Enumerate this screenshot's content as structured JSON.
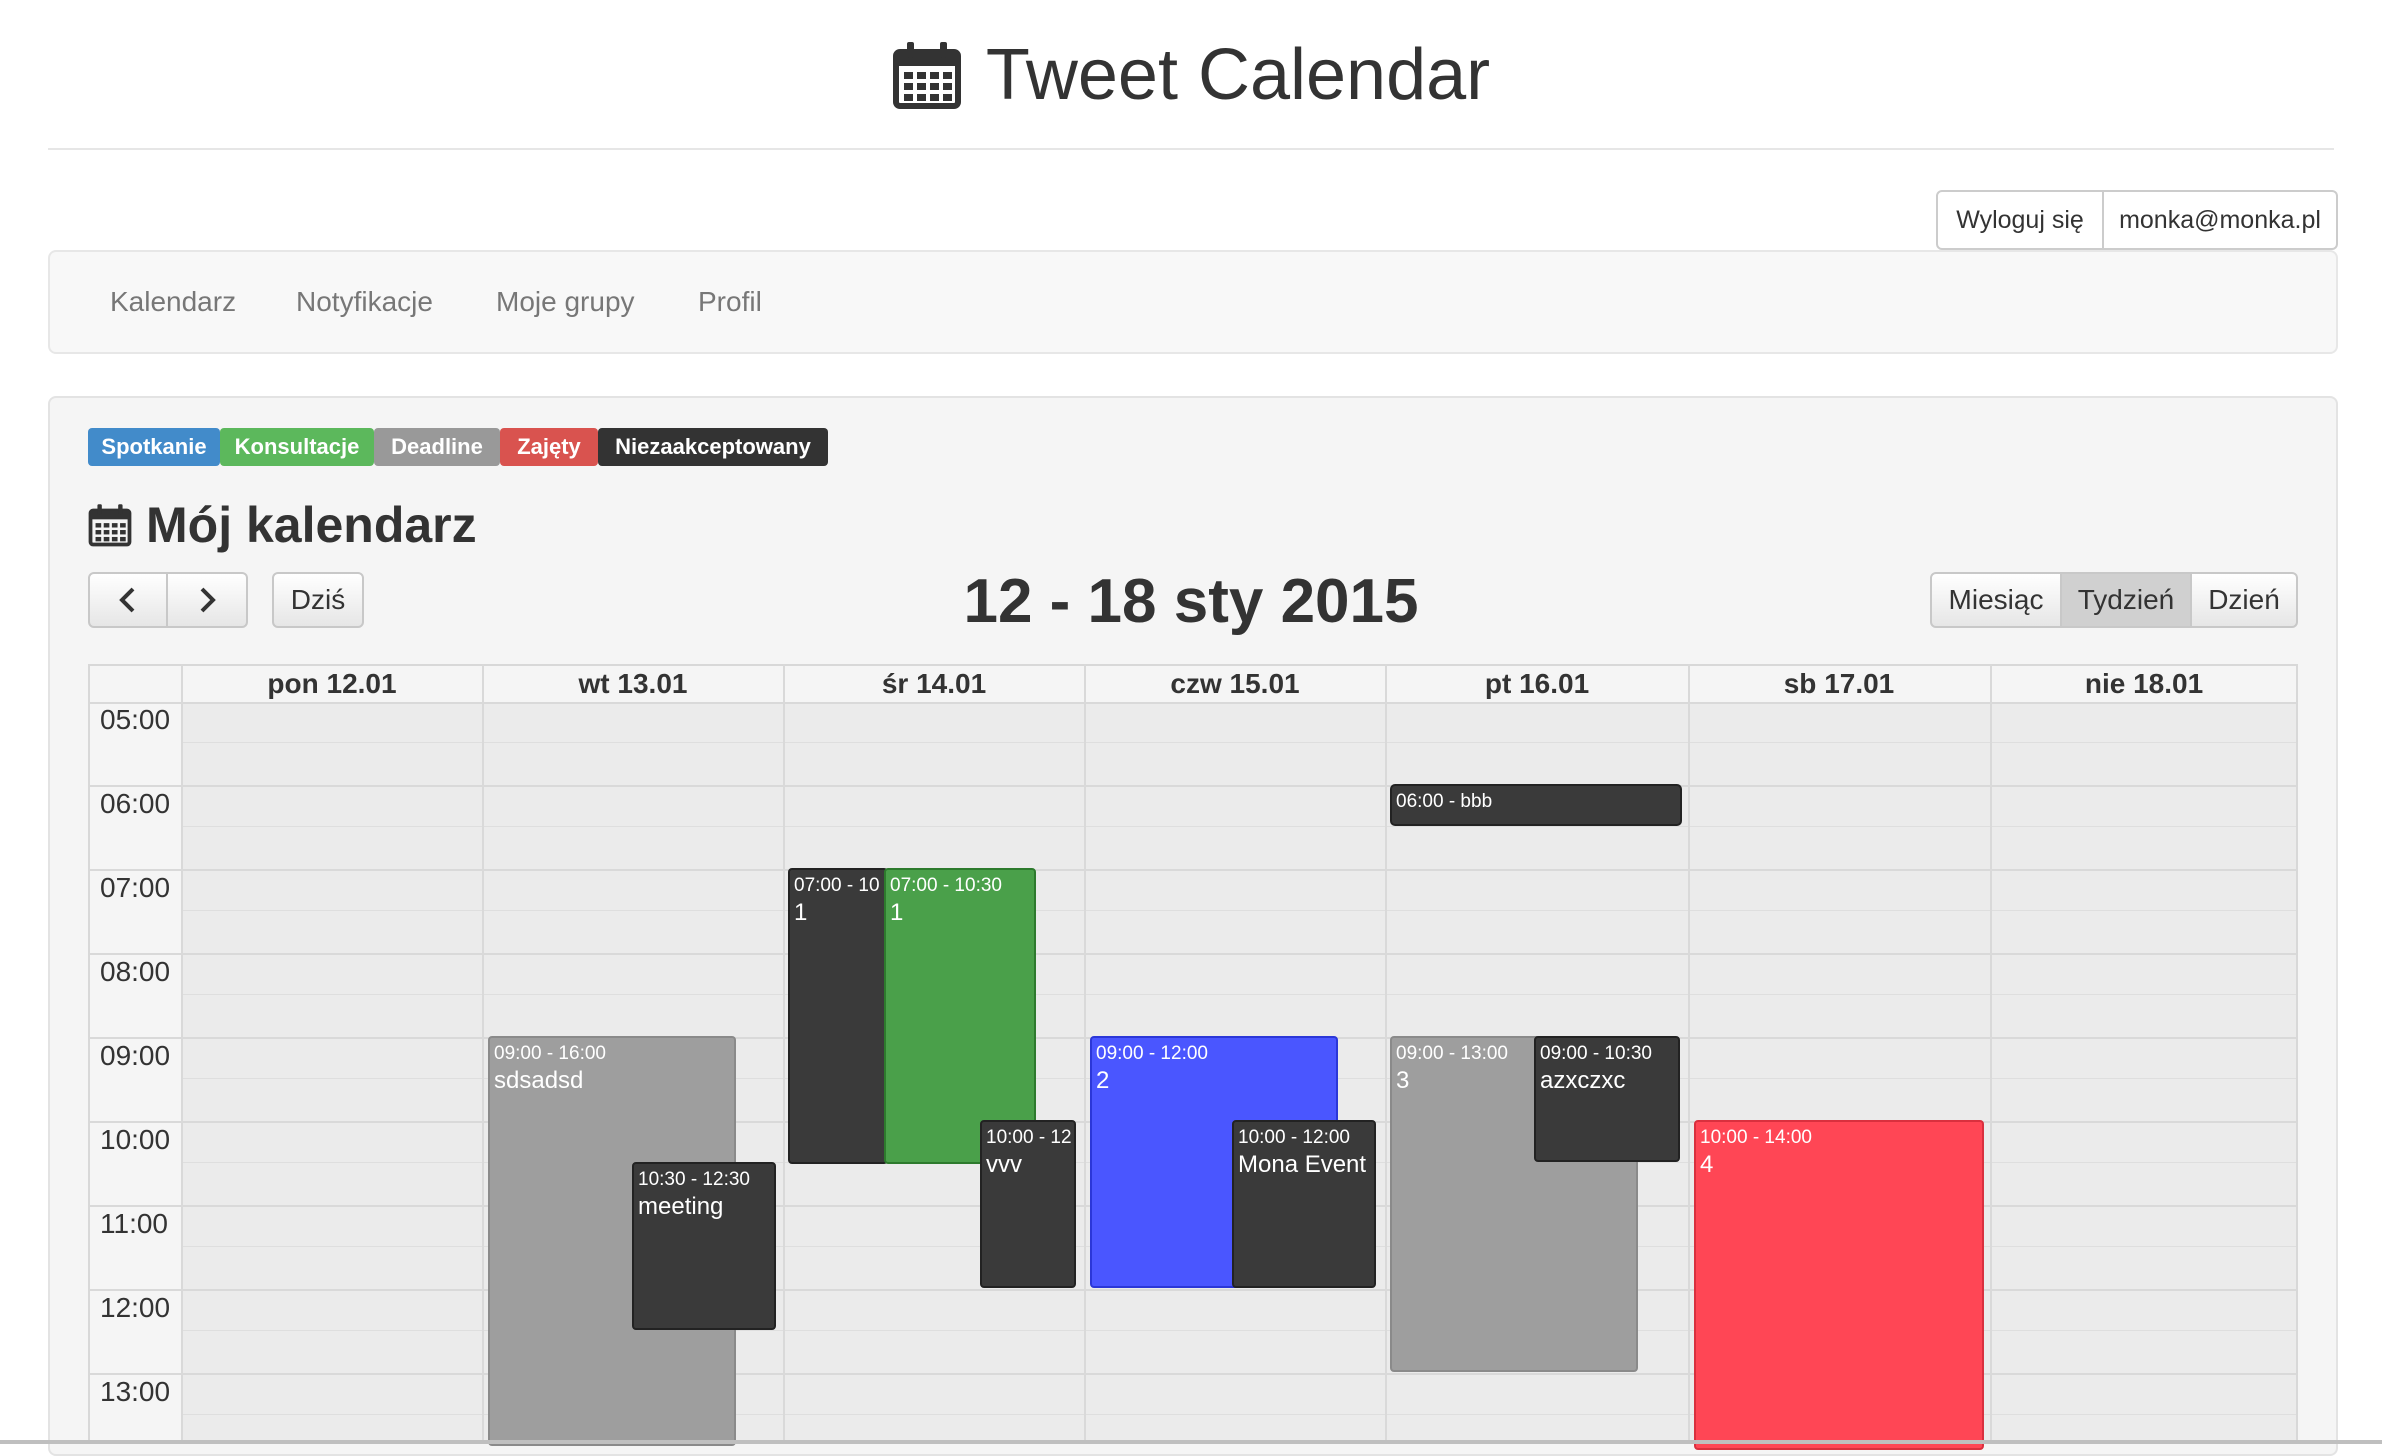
{
  "header": {
    "title": "Tweet Calendar",
    "icon": "calendar-icon"
  },
  "user": {
    "logout_label": "Wyloguj się",
    "email": "monka@monka.pl"
  },
  "nav": {
    "items": [
      "Kalendarz",
      "Notyfikacje",
      "Moje grupy",
      "Profil"
    ]
  },
  "legend": [
    {
      "label": "Spotkanie",
      "color": "#428bca"
    },
    {
      "label": "Konsultacje",
      "color": "#5cb85c"
    },
    {
      "label": "Deadline",
      "color": "#999999"
    },
    {
      "label": "Zajęty",
      "color": "#d9534f"
    },
    {
      "label": "Niezaakceptowany",
      "color": "#333333"
    }
  ],
  "calendar": {
    "section_title": "Mój kalendarz",
    "range": "12 - 18 sty 2015",
    "today_label": "Dziś",
    "views": [
      "Miesiąc",
      "Tydzień",
      "Dzień"
    ],
    "active_view": "Tydzień",
    "days": [
      "pon 12.01",
      "wt 13.01",
      "śr 14.01",
      "czw 15.01",
      "pt 16.01",
      "sb 17.01",
      "nie 18.01"
    ],
    "times": [
      "05:00",
      "06:00",
      "07:00",
      "08:00",
      "09:00",
      "10:00",
      "11:00",
      "12:00",
      "13:00"
    ],
    "events": [
      {
        "time": "06:00 - bbb",
        "title": "",
        "color": "#3a3a3a"
      },
      {
        "time": "07:00 - 10",
        "title": "1",
        "color": "#3a3a3a"
      },
      {
        "time": "07:00 - 10:30",
        "title": "1",
        "color": "#4aa04a"
      },
      {
        "time": "10:00 - 12",
        "title": "vvv",
        "color": "#3a3a3a"
      },
      {
        "time": "09:00 - 16:00",
        "title": "sdsadsd",
        "color": "#9e9e9e"
      },
      {
        "time": "10:30 - 12:30",
        "title": "meeting",
        "color": "#3a3a3a"
      },
      {
        "time": "09:00 - 12:00",
        "title": "2",
        "color": "#4a56ff"
      },
      {
        "time": "10:00 - 12:00",
        "title": "Mona Event",
        "color": "#3a3a3a"
      },
      {
        "time": "09:00 - 13:00",
        "title": "3",
        "color": "#9e9e9e"
      },
      {
        "time": "09:00 - 10:30",
        "title": "azxczxc",
        "color": "#3a3a3a"
      },
      {
        "time": "10:00 - 14:00",
        "title": "4",
        "color": "#ff4655"
      }
    ]
  }
}
